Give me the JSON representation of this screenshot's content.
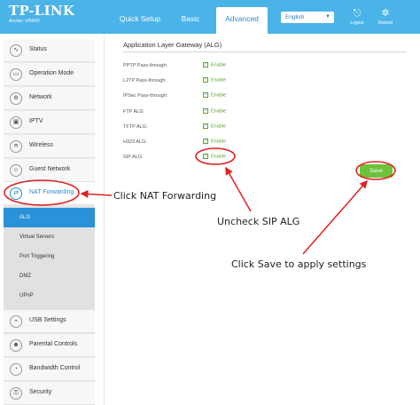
{
  "header": {
    "logo": "TP-LINK",
    "model": "Archer VR600",
    "tabs": [
      {
        "label": "Quick Setup"
      },
      {
        "label": "Basic"
      },
      {
        "label": "Advanced"
      }
    ],
    "language": "English",
    "logout_label": "Logout",
    "reboot_label": "Reboot"
  },
  "sidebar": {
    "items": [
      {
        "label": "Status",
        "icon": "pulse-icon"
      },
      {
        "label": "Operation Mode",
        "icon": "monitor-icon"
      },
      {
        "label": "Network",
        "icon": "globe-icon"
      },
      {
        "label": "IPTV",
        "icon": "tv-icon"
      },
      {
        "label": "Wireless",
        "icon": "wifi-icon"
      },
      {
        "label": "Guest Network",
        "icon": "people-icon"
      },
      {
        "label": "NAT Forwarding",
        "icon": "nat-icon"
      },
      {
        "label": "USB Settings",
        "icon": "usb-icon"
      },
      {
        "label": "Parental Controls",
        "icon": "parental-icon"
      },
      {
        "label": "Bandwidth Control",
        "icon": "bandwidth-icon"
      },
      {
        "label": "Security",
        "icon": "lock-icon"
      }
    ],
    "subitems": [
      {
        "label": "ALG"
      },
      {
        "label": "Virtual Servers"
      },
      {
        "label": "Port Triggering"
      },
      {
        "label": "DMZ"
      },
      {
        "label": "UPnP"
      }
    ]
  },
  "main": {
    "title": "Application Layer Gateway (ALG)",
    "rows": [
      {
        "label": "PPTP Pass-through:",
        "check": "Enable"
      },
      {
        "label": "L2TP Pass-through:",
        "check": "Enable"
      },
      {
        "label": "IPSec Pass-through:",
        "check": "Enable"
      },
      {
        "label": "FTP ALG:",
        "check": "Enable"
      },
      {
        "label": "TFTP ALG:",
        "check": "Enable"
      },
      {
        "label": "H323 ALG:",
        "check": "Enable"
      },
      {
        "label": "SIP ALG:",
        "check": "Enable"
      }
    ],
    "save_label": "Save"
  },
  "annotations": {
    "nat": "Click NAT Forwarding",
    "sip": "Uncheck SIP ALG",
    "save": "Click Save to apply settings"
  },
  "colors": {
    "header": "#4ab3e8",
    "accent_blue": "#2a92d8",
    "enable_green": "#58a52e",
    "save_green": "#6ec23a",
    "annotation_red": "#e02020"
  }
}
